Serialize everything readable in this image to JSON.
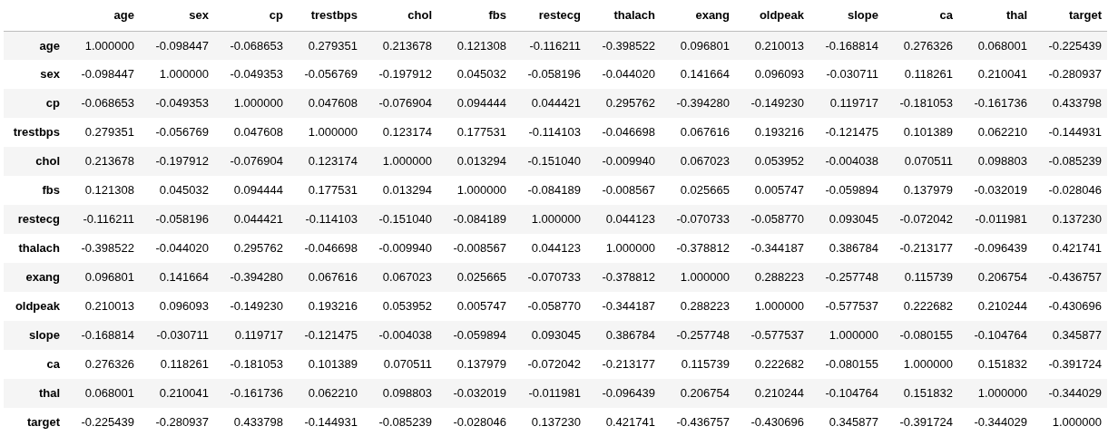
{
  "table": {
    "columns": [
      "age",
      "sex",
      "cp",
      "trestbps",
      "chol",
      "fbs",
      "restecg",
      "thalach",
      "exang",
      "oldpeak",
      "slope",
      "ca",
      "thal",
      "target"
    ],
    "rows": [
      {
        "label": "age",
        "cells": [
          "1.000000",
          "-0.098447",
          "-0.068653",
          "0.279351",
          "0.213678",
          "0.121308",
          "-0.116211",
          "-0.398522",
          "0.096801",
          "0.210013",
          "-0.168814",
          "0.276326",
          "0.068001",
          "-0.225439"
        ]
      },
      {
        "label": "sex",
        "cells": [
          "-0.098447",
          "1.000000",
          "-0.049353",
          "-0.056769",
          "-0.197912",
          "0.045032",
          "-0.058196",
          "-0.044020",
          "0.141664",
          "0.096093",
          "-0.030711",
          "0.118261",
          "0.210041",
          "-0.280937"
        ]
      },
      {
        "label": "cp",
        "cells": [
          "-0.068653",
          "-0.049353",
          "1.000000",
          "0.047608",
          "-0.076904",
          "0.094444",
          "0.044421",
          "0.295762",
          "-0.394280",
          "-0.149230",
          "0.119717",
          "-0.181053",
          "-0.161736",
          "0.433798"
        ]
      },
      {
        "label": "trestbps",
        "cells": [
          "0.279351",
          "-0.056769",
          "0.047608",
          "1.000000",
          "0.123174",
          "0.177531",
          "-0.114103",
          "-0.046698",
          "0.067616",
          "0.193216",
          "-0.121475",
          "0.101389",
          "0.062210",
          "-0.144931"
        ]
      },
      {
        "label": "chol",
        "cells": [
          "0.213678",
          "-0.197912",
          "-0.076904",
          "0.123174",
          "1.000000",
          "0.013294",
          "-0.151040",
          "-0.009940",
          "0.067023",
          "0.053952",
          "-0.004038",
          "0.070511",
          "0.098803",
          "-0.085239"
        ]
      },
      {
        "label": "fbs",
        "cells": [
          "0.121308",
          "0.045032",
          "0.094444",
          "0.177531",
          "0.013294",
          "1.000000",
          "-0.084189",
          "-0.008567",
          "0.025665",
          "0.005747",
          "-0.059894",
          "0.137979",
          "-0.032019",
          "-0.028046"
        ]
      },
      {
        "label": "restecg",
        "cells": [
          "-0.116211",
          "-0.058196",
          "0.044421",
          "-0.114103",
          "-0.151040",
          "-0.084189",
          "1.000000",
          "0.044123",
          "-0.070733",
          "-0.058770",
          "0.093045",
          "-0.072042",
          "-0.011981",
          "0.137230"
        ]
      },
      {
        "label": "thalach",
        "cells": [
          "-0.398522",
          "-0.044020",
          "0.295762",
          "-0.046698",
          "-0.009940",
          "-0.008567",
          "0.044123",
          "1.000000",
          "-0.378812",
          "-0.344187",
          "0.386784",
          "-0.213177",
          "-0.096439",
          "0.421741"
        ]
      },
      {
        "label": "exang",
        "cells": [
          "0.096801",
          "0.141664",
          "-0.394280",
          "0.067616",
          "0.067023",
          "0.025665",
          "-0.070733",
          "-0.378812",
          "1.000000",
          "0.288223",
          "-0.257748",
          "0.115739",
          "0.206754",
          "-0.436757"
        ]
      },
      {
        "label": "oldpeak",
        "cells": [
          "0.210013",
          "0.096093",
          "-0.149230",
          "0.193216",
          "0.053952",
          "0.005747",
          "-0.058770",
          "-0.344187",
          "0.288223",
          "1.000000",
          "-0.577537",
          "0.222682",
          "0.210244",
          "-0.430696"
        ]
      },
      {
        "label": "slope",
        "cells": [
          "-0.168814",
          "-0.030711",
          "0.119717",
          "-0.121475",
          "-0.004038",
          "-0.059894",
          "0.093045",
          "0.386784",
          "-0.257748",
          "-0.577537",
          "1.000000",
          "-0.080155",
          "-0.104764",
          "0.345877"
        ]
      },
      {
        "label": "ca",
        "cells": [
          "0.276326",
          "0.118261",
          "-0.181053",
          "0.101389",
          "0.070511",
          "0.137979",
          "-0.072042",
          "-0.213177",
          "0.115739",
          "0.222682",
          "-0.080155",
          "1.000000",
          "0.151832",
          "-0.391724"
        ]
      },
      {
        "label": "thal",
        "cells": [
          "0.068001",
          "0.210041",
          "-0.161736",
          "0.062210",
          "0.098803",
          "-0.032019",
          "-0.011981",
          "-0.096439",
          "0.206754",
          "0.210244",
          "-0.104764",
          "0.151832",
          "1.000000",
          "-0.344029"
        ]
      },
      {
        "label": "target",
        "cells": [
          "-0.225439",
          "-0.280937",
          "0.433798",
          "-0.144931",
          "-0.085239",
          "-0.028046",
          "0.137230",
          "0.421741",
          "-0.436757",
          "-0.430696",
          "0.345877",
          "-0.391724",
          "-0.344029",
          "1.000000"
        ]
      }
    ]
  }
}
